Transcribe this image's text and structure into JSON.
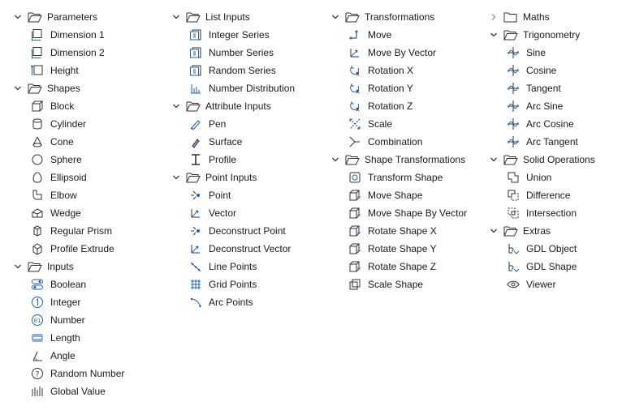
{
  "accent": "#1f5fbf",
  "columns": [
    {
      "categories": [
        {
          "label": "Parameters",
          "expanded": true,
          "items": [
            {
              "label": "Dimension 1",
              "icon": "dimension-icon"
            },
            {
              "label": "Dimension 2",
              "icon": "dimension-icon"
            },
            {
              "label": "Height",
              "icon": "height-icon"
            }
          ]
        },
        {
          "label": "Shapes",
          "expanded": true,
          "items": [
            {
              "label": "Block",
              "icon": "block-icon"
            },
            {
              "label": "Cylinder",
              "icon": "cylinder-icon"
            },
            {
              "label": "Cone",
              "icon": "cone-icon"
            },
            {
              "label": "Sphere",
              "icon": "sphere-icon"
            },
            {
              "label": "Ellipsoid",
              "icon": "ellipsoid-icon"
            },
            {
              "label": "Elbow",
              "icon": "elbow-icon"
            },
            {
              "label": "Wedge",
              "icon": "wedge-icon"
            },
            {
              "label": "Regular Prism",
              "icon": "prism-icon"
            },
            {
              "label": "Profile Extrude",
              "icon": "extrude-icon"
            }
          ]
        },
        {
          "label": "Inputs",
          "expanded": true,
          "items": [
            {
              "label": "Boolean",
              "icon": "toggle-icon"
            },
            {
              "label": "Integer",
              "icon": "integer-icon"
            },
            {
              "label": "Number",
              "icon": "number-icon"
            },
            {
              "label": "Length",
              "icon": "length-icon"
            },
            {
              "label": "Angle",
              "icon": "angle-icon"
            },
            {
              "label": "Random Number",
              "icon": "random-icon"
            },
            {
              "label": "Global Value",
              "icon": "global-value-icon"
            }
          ]
        }
      ]
    },
    {
      "categories": [
        {
          "label": "List Inputs",
          "expanded": true,
          "items": [
            {
              "label": "Integer Series",
              "icon": "series-icon"
            },
            {
              "label": "Number Series",
              "icon": "series-icon"
            },
            {
              "label": "Random Series",
              "icon": "series-icon"
            },
            {
              "label": "Number Distribution",
              "icon": "distribution-icon"
            }
          ]
        },
        {
          "label": "Attribute Inputs",
          "expanded": true,
          "items": [
            {
              "label": "Pen",
              "icon": "pen-icon"
            },
            {
              "label": "Surface",
              "icon": "surface-icon"
            },
            {
              "label": "Profile",
              "icon": "profile-icon"
            }
          ]
        },
        {
          "label": "Point Inputs",
          "expanded": true,
          "items": [
            {
              "label": "Point",
              "icon": "point-icon"
            },
            {
              "label": "Vector",
              "icon": "vector-icon"
            },
            {
              "label": "Deconstruct Point",
              "icon": "point-icon"
            },
            {
              "label": "Deconstruct Vector",
              "icon": "vector-icon"
            },
            {
              "label": "Line Points",
              "icon": "line-points-icon"
            },
            {
              "label": "Grid Points",
              "icon": "grid-icon"
            },
            {
              "label": "Arc Points",
              "icon": "arc-icon"
            }
          ]
        }
      ]
    },
    {
      "categories": [
        {
          "label": "Transformations",
          "expanded": true,
          "items": [
            {
              "label": "Move",
              "icon": "move-icon"
            },
            {
              "label": "Move By Vector",
              "icon": "vector-icon"
            },
            {
              "label": "Rotation X",
              "icon": "rotate-icon"
            },
            {
              "label": "Rotation Y",
              "icon": "rotate-icon"
            },
            {
              "label": "Rotation Z",
              "icon": "rotate-icon"
            },
            {
              "label": "Scale",
              "icon": "scale-icon"
            },
            {
              "label": "Combination",
              "icon": "combination-icon"
            }
          ]
        },
        {
          "label": "Shape Transformations",
          "expanded": true,
          "items": [
            {
              "label": "Transform Shape",
              "icon": "transform-shape-icon"
            },
            {
              "label": "Move Shape",
              "icon": "shape-icon"
            },
            {
              "label": "Move Shape By Vector",
              "icon": "shape-icon"
            },
            {
              "label": "Rotate Shape X",
              "icon": "shape-icon"
            },
            {
              "label": "Rotate Shape Y",
              "icon": "shape-icon"
            },
            {
              "label": "Rotate Shape Z",
              "icon": "shape-icon"
            },
            {
              "label": "Scale Shape",
              "icon": "scale-shape-icon"
            }
          ]
        }
      ]
    },
    {
      "categories": [
        {
          "label": "Maths",
          "expanded": false,
          "items": []
        },
        {
          "label": "Trigonometry",
          "expanded": true,
          "items": [
            {
              "label": "Sine",
              "icon": "trig-icon"
            },
            {
              "label": "Cosine",
              "icon": "trig-icon"
            },
            {
              "label": "Tangent",
              "icon": "trig-icon"
            },
            {
              "label": "Arc Sine",
              "icon": "trig-icon"
            },
            {
              "label": "Arc Cosine",
              "icon": "trig-icon"
            },
            {
              "label": "Arc Tangent",
              "icon": "trig-icon"
            }
          ]
        },
        {
          "label": "Solid Operations",
          "expanded": true,
          "items": [
            {
              "label": "Union",
              "icon": "union-icon"
            },
            {
              "label": "Difference",
              "icon": "difference-icon"
            },
            {
              "label": "Intersection",
              "icon": "intersection-icon"
            }
          ]
        },
        {
          "label": "Extras",
          "expanded": true,
          "items": [
            {
              "label": "GDL Object",
              "icon": "gdl-icon"
            },
            {
              "label": "GDL Shape",
              "icon": "gdl-icon"
            },
            {
              "label": "Viewer",
              "icon": "eye-icon"
            }
          ]
        }
      ]
    }
  ]
}
